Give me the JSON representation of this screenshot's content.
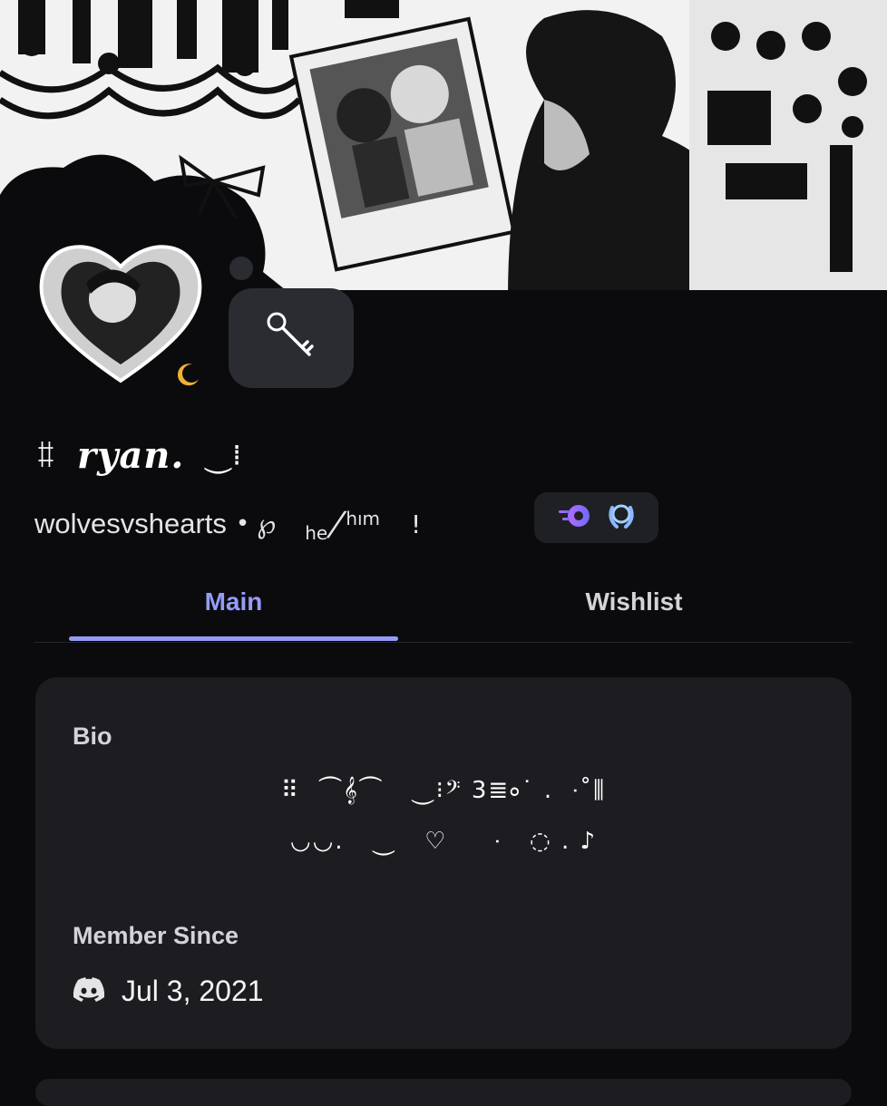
{
  "profile": {
    "name_prefix": "ꐚ",
    "display_name": "ryan.",
    "name_suffix": "⏝⁞",
    "handle": "wolvesvshearts",
    "separator": "•",
    "pronoun_a": "℘",
    "pronoun_b": "he",
    "pronoun_slash": "/",
    "pronoun_c": "hım",
    "pronoun_d": "!",
    "status": "idle"
  },
  "tabs": [
    {
      "label": "Main",
      "active": true
    },
    {
      "label": "Wishlist",
      "active": false
    }
  ],
  "bio": {
    "label": "Bio",
    "line1": "⠿  ⏜𝄞⏜   ⏝⁝𝄢 3≣⸰˙ .  ⸱˚⫼",
    "line2": "◡◡.   ⏝   ♡     ⸱   ◌ . ♪"
  },
  "member_since": {
    "label": "Member Since",
    "date": "Jul 3, 2021"
  },
  "colors": {
    "accent": "#949cf7",
    "background": "#0b0b0d",
    "card": "#1c1c21",
    "idle": "#f0b132"
  },
  "icons": [
    "moon-icon",
    "key-icon",
    "nitro-icon",
    "laurel-badge-icon",
    "discord-icon"
  ]
}
